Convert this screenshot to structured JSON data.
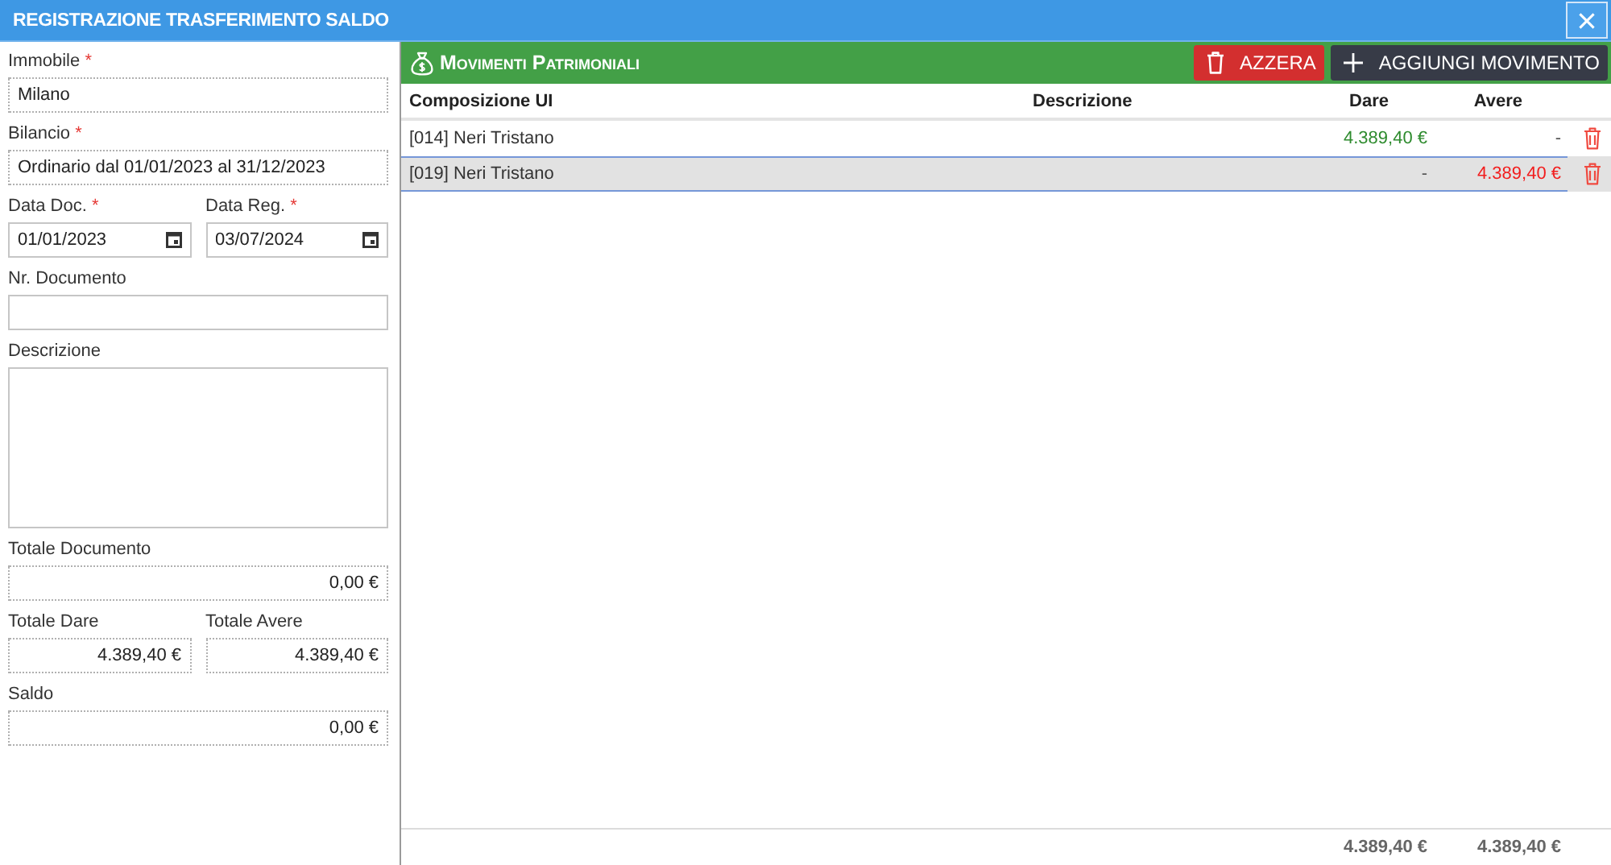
{
  "window": {
    "title": "REGISTRAZIONE TRASFERIMENTO SALDO"
  },
  "form": {
    "rows": [
      {
        "fields": [
          {
            "kind": "text",
            "label": "Immobile",
            "required_mark": "*",
            "value": "Milano",
            "readonly": true
          }
        ]
      },
      {
        "fields": [
          {
            "kind": "text",
            "label": "Bilancio",
            "required_mark": "*",
            "value": "Ordinario dal 01/01/2023 al 31/12/2023",
            "readonly": true
          }
        ]
      },
      {
        "fields": [
          {
            "kind": "date",
            "label": "Data Doc.",
            "required_mark": "*",
            "value": "01/01/2023",
            "readonly": false
          },
          {
            "kind": "date",
            "label": "Data Reg.",
            "required_mark": "*",
            "value": "03/07/2024",
            "readonly": false
          }
        ]
      },
      {
        "fields": [
          {
            "kind": "text",
            "label": "Nr. Documento",
            "readonly": false
          }
        ]
      },
      {
        "fields": [
          {
            "kind": "textarea",
            "label": "Descrizione",
            "readonly": false
          }
        ]
      },
      {
        "fields": [
          {
            "kind": "amount",
            "label": "Totale Documento",
            "value": "0,00 €",
            "readonly": true
          }
        ]
      },
      {
        "fields": [
          {
            "kind": "amount",
            "label": "Totale Dare",
            "value": "4.389,40 €",
            "readonly": true
          },
          {
            "kind": "amount",
            "label": "Totale Avere",
            "value": "4.389,40 €",
            "readonly": true
          }
        ]
      },
      {
        "fields": [
          {
            "kind": "amount",
            "label": "Saldo",
            "value": "0,00 €",
            "readonly": true
          }
        ]
      }
    ]
  },
  "panel": {
    "title": "Movimenti Patrimoniali",
    "buttons": [
      {
        "kind": "reset",
        "label": "AZZERA"
      },
      {
        "kind": "add",
        "label": "AGGIUNGI MOVIMENTO"
      }
    ]
  },
  "table": {
    "columns": [
      {
        "kind": "text",
        "label": "Composizione UI"
      },
      {
        "kind": "text",
        "label": "Descrizione"
      },
      {
        "kind": "amount",
        "label": "Dare"
      },
      {
        "kind": "amount",
        "label": "Avere"
      }
    ],
    "rows": [
      {
        "selected": false,
        "composizione": "[014] Neri Tristano",
        "dare": {
          "text": "4.389,40 €",
          "color": "#2e8b2e"
        },
        "avere": {
          "text": "-"
        }
      },
      {
        "selected": true,
        "composizione": "[019] Neri Tristano",
        "dare": {
          "text": "-"
        },
        "avere": {
          "text": "4.389,40 €",
          "color": "#f21d1d"
        }
      }
    ],
    "totals": {
      "dare": "4.389,40 €",
      "avere": "4.389,40 €"
    }
  }
}
